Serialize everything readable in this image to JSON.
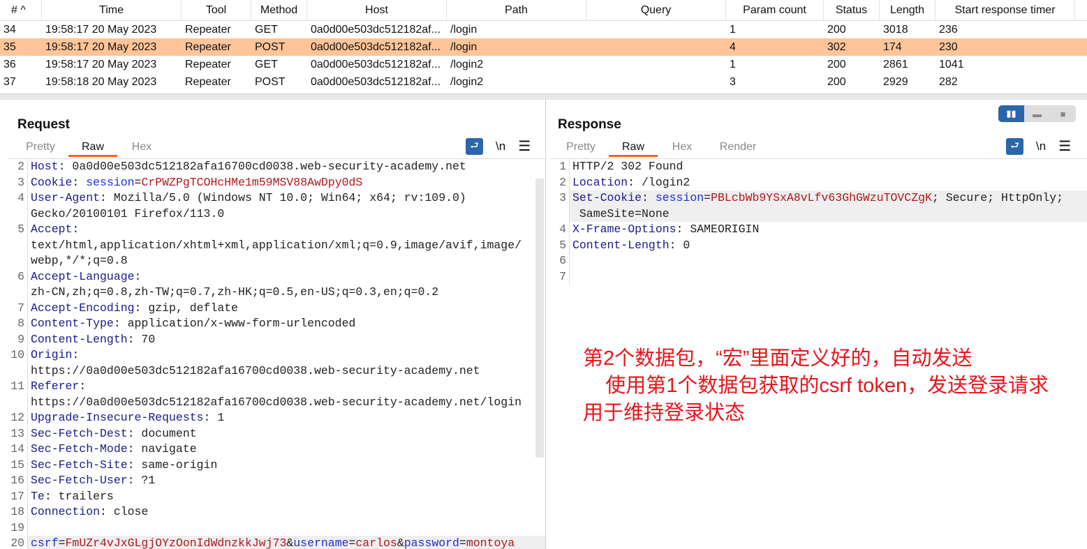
{
  "table": {
    "headers": [
      "# ^",
      "Time",
      "Tool",
      "Method",
      "Host",
      "Path",
      "Query",
      "Param count",
      "Status",
      "Length",
      "Start response timer"
    ],
    "rows": [
      [
        "34",
        "19:58:17 20 May 2023",
        "Repeater",
        "GET",
        "0a0d00e503dc512182af...",
        "/login",
        "",
        "1",
        "200",
        "3018",
        "236"
      ],
      [
        "35",
        "19:58:17 20 May 2023",
        "Repeater",
        "POST",
        "0a0d00e503dc512182af...",
        "/login",
        "",
        "4",
        "302",
        "174",
        "230"
      ],
      [
        "36",
        "19:58:17 20 May 2023",
        "Repeater",
        "GET",
        "0a0d00e503dc512182af...",
        "/login2",
        "",
        "1",
        "200",
        "2861",
        "1041"
      ],
      [
        "37",
        "19:58:18 20 May 2023",
        "Repeater",
        "POST",
        "0a0d00e503dc512182af...",
        "/login2",
        "",
        "3",
        "200",
        "2929",
        "282"
      ]
    ],
    "selected_row": 1
  },
  "request": {
    "title": "Request",
    "tabs": [
      "Pretty",
      "Raw",
      "Hex"
    ],
    "active_tab": "Raw",
    "newline_label": "\\n",
    "lines": [
      {
        "n": "2",
        "rows": [
          [
            [
              "k",
              "Host"
            ],
            [
              "v",
              ": 0a0d00e503dc512182afa16700cd0038.web-security-academy.net"
            ]
          ]
        ]
      },
      {
        "n": "3",
        "rows": [
          [
            [
              "k",
              "Cookie"
            ],
            [
              "v",
              ": "
            ],
            [
              "b",
              "session"
            ],
            [
              "v",
              "="
            ],
            [
              "r",
              "CrPWZPgTCOHcHMe1m59MSV88AwDpy0dS"
            ]
          ]
        ]
      },
      {
        "n": "4",
        "rows": [
          [
            [
              "k",
              "User-Agent"
            ],
            [
              "v",
              ": Mozilla/5.0 (Windows NT 10.0; Win64; x64; rv:109.0)"
            ]
          ],
          [
            [
              "v",
              "Gecko/20100101 Firefox/113.0"
            ]
          ]
        ]
      },
      {
        "n": "5",
        "rows": [
          [
            [
              "k",
              "Accept"
            ],
            [
              "v",
              ":"
            ]
          ],
          [
            [
              "v",
              "text/html,application/xhtml+xml,application/xml;q=0.9,image/avif,image/"
            ]
          ],
          [
            [
              "v",
              "webp,*/*;q=0.8"
            ]
          ]
        ]
      },
      {
        "n": "6",
        "rows": [
          [
            [
              "k",
              "Accept-Language"
            ],
            [
              "v",
              ":"
            ]
          ],
          [
            [
              "v",
              "zh-CN,zh;q=0.8,zh-TW;q=0.7,zh-HK;q=0.5,en-US;q=0.3,en;q=0.2"
            ]
          ]
        ]
      },
      {
        "n": "7",
        "rows": [
          [
            [
              "k",
              "Accept-Encoding"
            ],
            [
              "v",
              ": gzip, deflate"
            ]
          ]
        ]
      },
      {
        "n": "8",
        "rows": [
          [
            [
              "k",
              "Content-Type"
            ],
            [
              "v",
              ": application/x-www-form-urlencoded"
            ]
          ]
        ]
      },
      {
        "n": "9",
        "rows": [
          [
            [
              "k",
              "Content-Length"
            ],
            [
              "v",
              ": 70"
            ]
          ]
        ]
      },
      {
        "n": "10",
        "rows": [
          [
            [
              "k",
              "Origin"
            ],
            [
              "v",
              ":"
            ]
          ],
          [
            [
              "v",
              "https://0a0d00e503dc512182afa16700cd0038.web-security-academy.net"
            ]
          ]
        ]
      },
      {
        "n": "11",
        "rows": [
          [
            [
              "k",
              "Referer"
            ],
            [
              "v",
              ":"
            ]
          ],
          [
            [
              "v",
              "https://0a0d00e503dc512182afa16700cd0038.web-security-academy.net/login"
            ]
          ]
        ]
      },
      {
        "n": "12",
        "rows": [
          [
            [
              "k",
              "Upgrade-Insecure-Requests"
            ],
            [
              "v",
              ": 1"
            ]
          ]
        ]
      },
      {
        "n": "13",
        "rows": [
          [
            [
              "k",
              "Sec-Fetch-Dest"
            ],
            [
              "v",
              ": document"
            ]
          ]
        ]
      },
      {
        "n": "14",
        "rows": [
          [
            [
              "k",
              "Sec-Fetch-Mode"
            ],
            [
              "v",
              ": navigate"
            ]
          ]
        ]
      },
      {
        "n": "15",
        "rows": [
          [
            [
              "k",
              "Sec-Fetch-Site"
            ],
            [
              "v",
              ": same-origin"
            ]
          ]
        ]
      },
      {
        "n": "16",
        "rows": [
          [
            [
              "k",
              "Sec-Fetch-User"
            ],
            [
              "v",
              ": ?1"
            ]
          ]
        ]
      },
      {
        "n": "17",
        "rows": [
          [
            [
              "k",
              "Te"
            ],
            [
              "v",
              ": trailers"
            ]
          ]
        ]
      },
      {
        "n": "18",
        "rows": [
          [
            [
              "k",
              "Connection"
            ],
            [
              "v",
              ": close"
            ]
          ]
        ]
      },
      {
        "n": "19",
        "rows": [
          [
            [
              "v",
              ""
            ]
          ]
        ]
      },
      {
        "n": "20",
        "hl": true,
        "rows": [
          [
            [
              "b",
              "csrf"
            ],
            [
              "v",
              "="
            ],
            [
              "r",
              "FmUZr4vJxGLgjOYzOonIdWdnzkkJwj73"
            ],
            [
              "v",
              "&"
            ],
            [
              "b",
              "username"
            ],
            [
              "v",
              "="
            ],
            [
              "r",
              "carlos"
            ],
            [
              "v",
              "&"
            ],
            [
              "b",
              "password"
            ],
            [
              "v",
              "="
            ],
            [
              "r",
              "montoya"
            ]
          ]
        ]
      }
    ]
  },
  "response": {
    "title": "Response",
    "tabs": [
      "Pretty",
      "Raw",
      "Hex",
      "Render"
    ],
    "active_tab": "Raw",
    "newline_label": "\\n",
    "lines": [
      {
        "n": "1",
        "rows": [
          [
            [
              "v",
              "HTTP/2 302 Found"
            ]
          ]
        ]
      },
      {
        "n": "2",
        "rows": [
          [
            [
              "k",
              "Location"
            ],
            [
              "v",
              ": /login2"
            ]
          ]
        ]
      },
      {
        "n": "3",
        "hl": true,
        "rows": [
          [
            [
              "k",
              "Set-Cookie"
            ],
            [
              "v",
              ": "
            ],
            [
              "b",
              "session"
            ],
            [
              "v",
              "="
            ],
            [
              "r",
              "PBLcbWb9YSxA8vLfv63GhGWzuTOVCZgK"
            ],
            [
              "v",
              "; Secure; HttpOnly;"
            ]
          ],
          [
            [
              "v",
              " SameSite=None"
            ]
          ]
        ]
      },
      {
        "n": "4",
        "rows": [
          [
            [
              "k",
              "X-Frame-Options"
            ],
            [
              "v",
              ": SAMEORIGIN"
            ]
          ]
        ]
      },
      {
        "n": "5",
        "rows": [
          [
            [
              "k",
              "Content-Length"
            ],
            [
              "v",
              ": 0"
            ]
          ]
        ]
      },
      {
        "n": "6",
        "rows": [
          [
            [
              "v",
              ""
            ]
          ]
        ]
      },
      {
        "n": "7",
        "rows": [
          [
            [
              "v",
              ""
            ]
          ]
        ]
      }
    ]
  },
  "annotation": {
    "lines": [
      "第2个数据包，“宏”里面定义好的，自动发送",
      "    使用第1个数据包获取的csrf token，发送登录请求",
      "用于维持登录状态"
    ]
  },
  "colors": {
    "selected_row": "#ffc599",
    "accent": "#f26522",
    "button": "#2a66a8",
    "annotation": "#e8141b"
  }
}
